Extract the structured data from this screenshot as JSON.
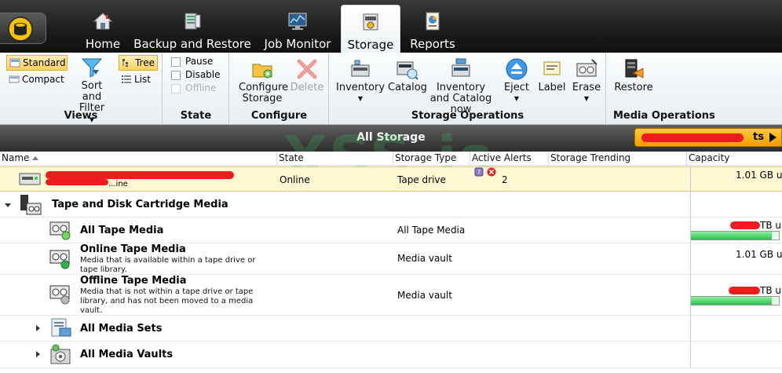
{
  "tabs": [
    {
      "label": "Home",
      "icon": "home-icon"
    },
    {
      "label": "Backup and Restore",
      "icon": "backup-restore-icon"
    },
    {
      "label": "Job Monitor",
      "icon": "job-monitor-icon"
    },
    {
      "label": "Storage",
      "icon": "storage-icon",
      "active": true
    },
    {
      "label": "Reports",
      "icon": "reports-icon"
    }
  ],
  "ribbon": {
    "views": {
      "label": "Views",
      "standard": "Standard",
      "compact": "Compact",
      "sort_filter": "Sort and Filter",
      "tree": "Tree",
      "list": "List"
    },
    "state": {
      "label": "State",
      "pause": "Pause",
      "disable": "Disable",
      "offline": "Offline"
    },
    "configure": {
      "label": "Configure",
      "configure_storage": "Configure Storage",
      "delete": "Delete"
    },
    "storage_operations": {
      "label": "Storage Operations",
      "inventory": "Inventory",
      "catalog": "Catalog",
      "inventory_catalog_now": "Inventory and Catalog now",
      "eject": "Eject",
      "label_btn": "Label",
      "erase": "Erase"
    },
    "media_operations": {
      "label": "Media Operations",
      "restore": "Restore"
    }
  },
  "band": {
    "title": "All Storage",
    "alerts_button_suffix": "ts"
  },
  "watermark": "XSS.is",
  "columns": [
    "Name",
    "State",
    "Storage Type",
    "Active Alerts",
    "Storage Trending",
    "Capacity"
  ],
  "rows": {
    "device": {
      "name_fragment": "...ine",
      "state": "Online",
      "storage_type": "Tape drive",
      "alerts_count": "2",
      "capacity": "1.01 GB u"
    },
    "group": {
      "title": "Tape and Disk Cartridge Media"
    },
    "all_tape": {
      "title": "All Tape Media",
      "storage_type": "All Tape Media",
      "capacity": "TB u",
      "capacity_fraction": 0.92
    },
    "online_tape": {
      "title": "Online Tape Media",
      "desc": "Media that is available within a tape drive or tape library.",
      "storage_type": "Media vault",
      "capacity": "1.01 GB u"
    },
    "offline_tape": {
      "title": "Offline Tape Media",
      "desc": "Media that is not within a tape drive or tape library, and has not been moved to a media vault.",
      "storage_type": "Media vault",
      "capacity": "TB u",
      "capacity_fraction": 0.92
    },
    "media_sets": {
      "title": "All Media Sets"
    },
    "media_vaults": {
      "title": "All Media Vaults"
    }
  },
  "colors": {
    "accent_orange": "#f29d00",
    "selected_yellow": "#ffd35c",
    "highlight_row": "#fff8d2",
    "capacity_green": "#27c24c"
  }
}
